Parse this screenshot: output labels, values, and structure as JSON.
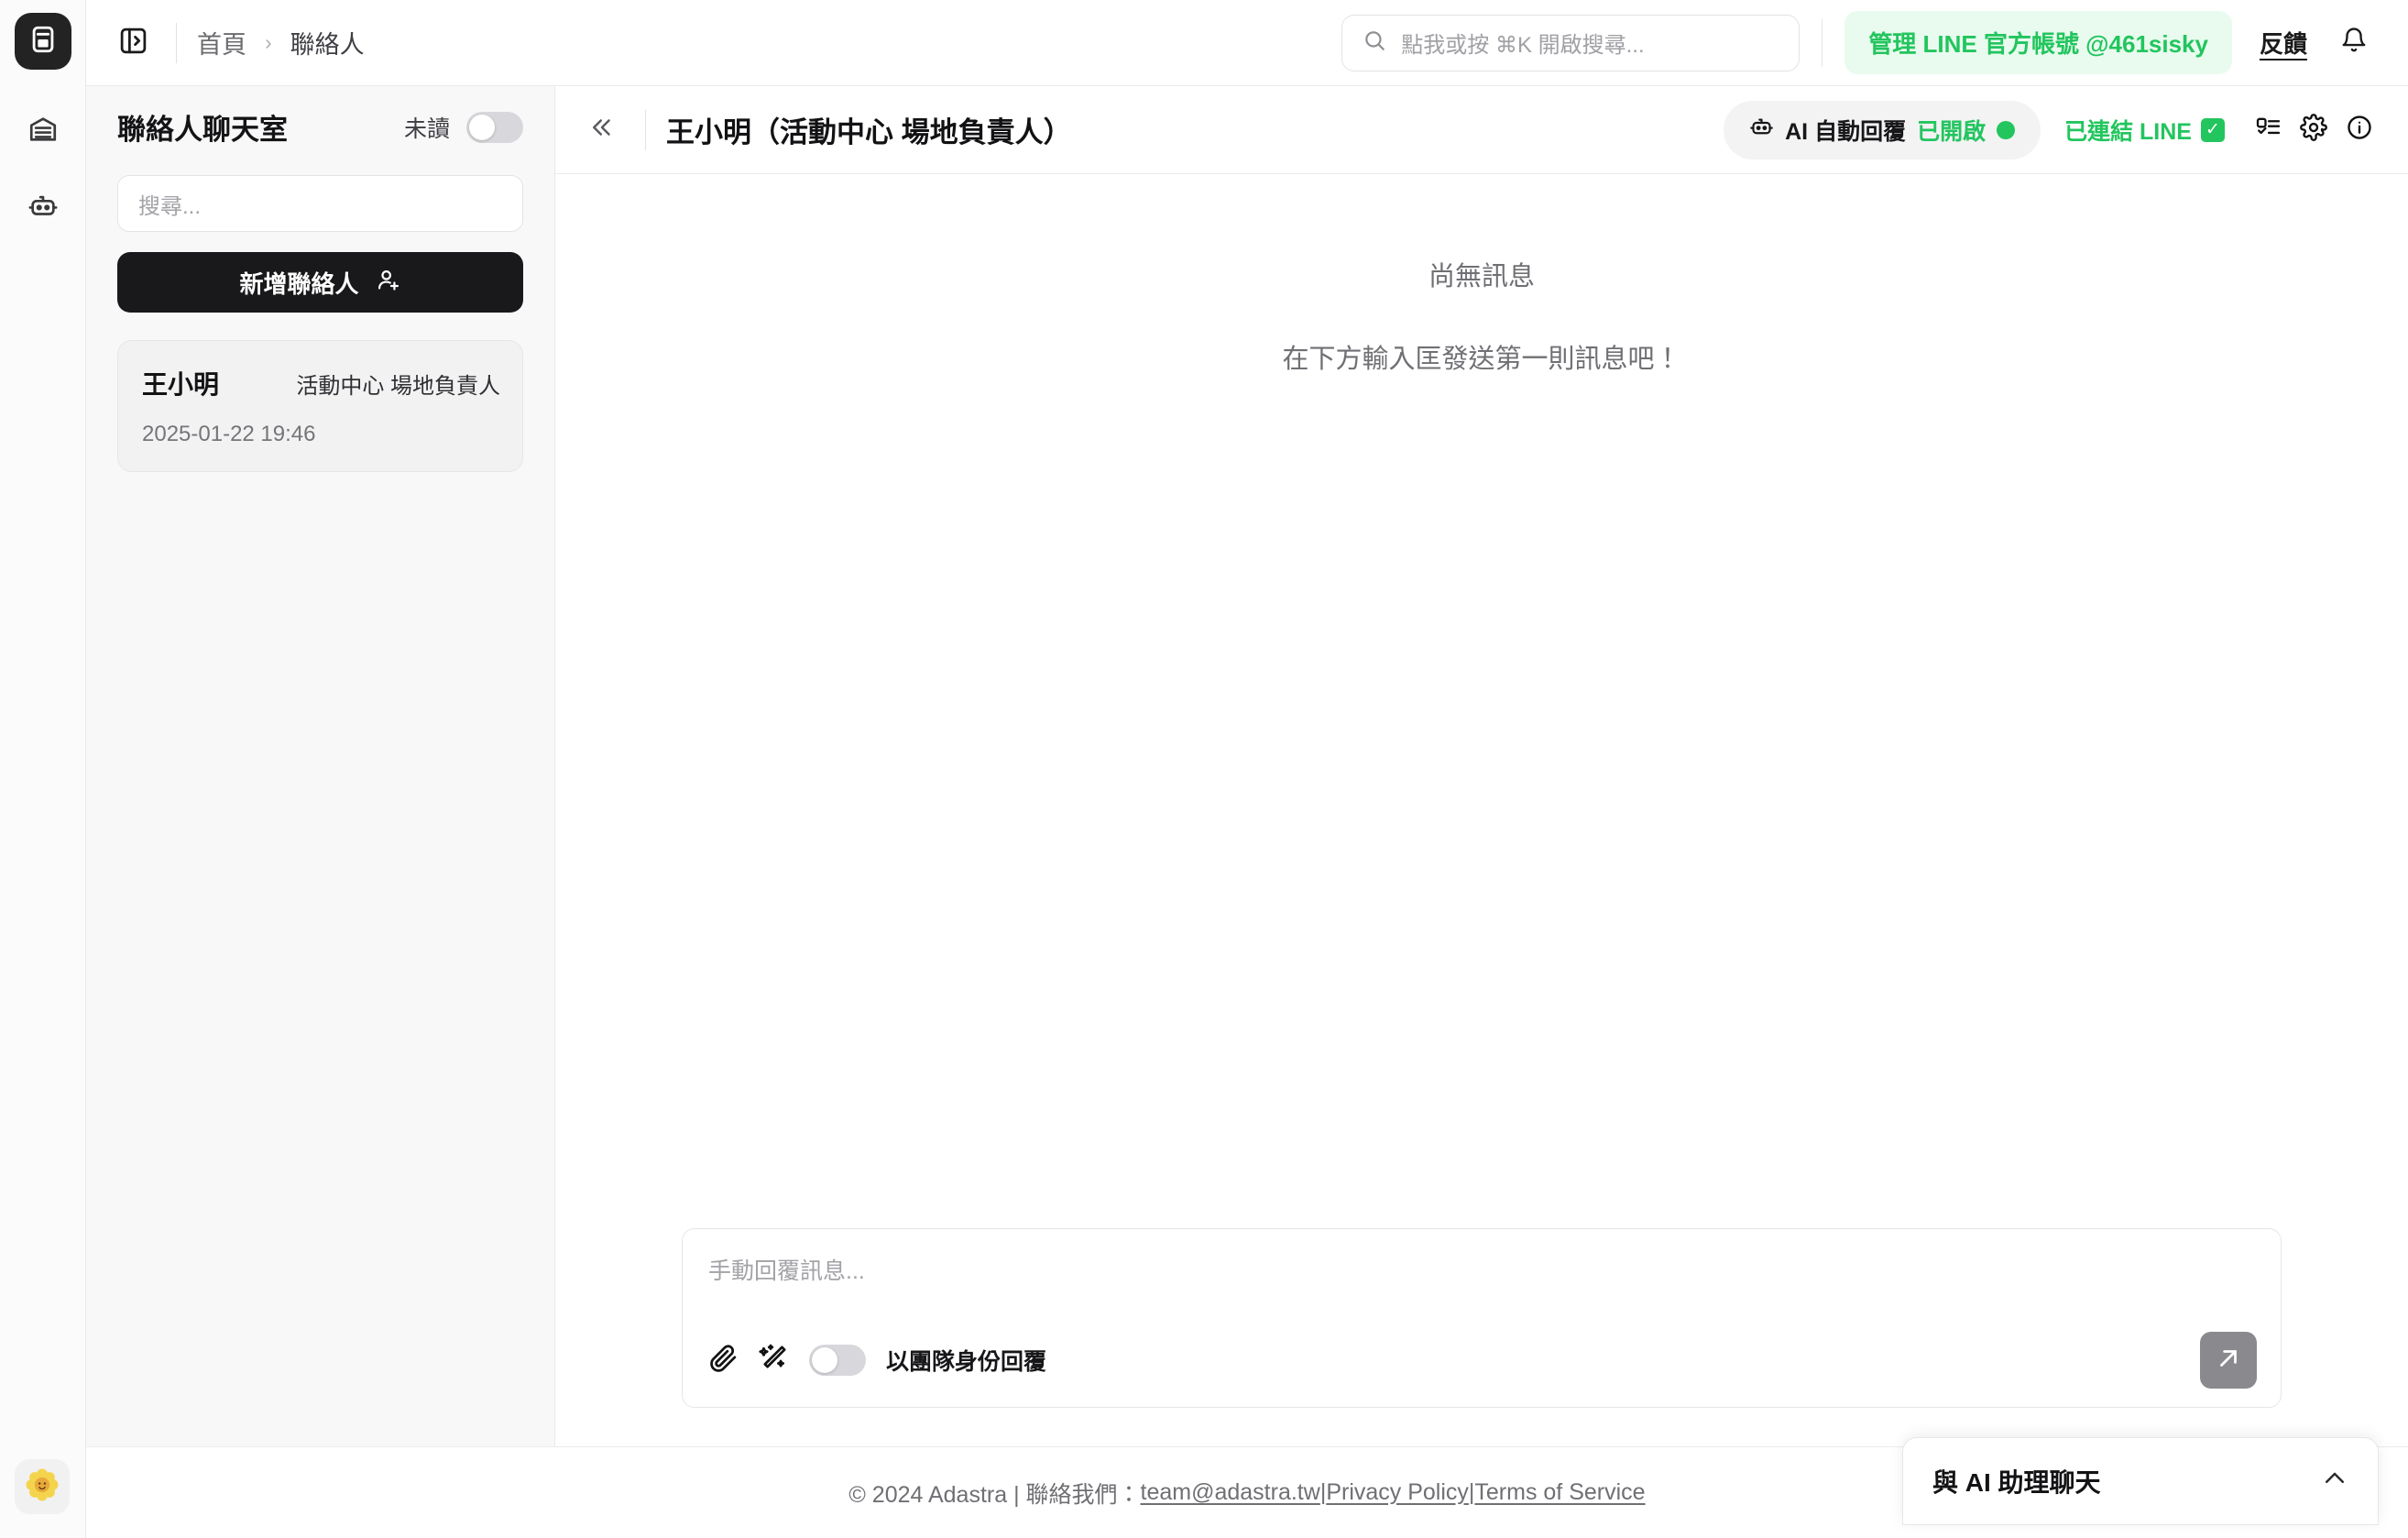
{
  "rail": {
    "logo_icon": "archive-box-icon",
    "items": [
      {
        "icon": "warehouse-icon",
        "name": "warehouse"
      },
      {
        "icon": "robot-icon",
        "name": "robot"
      }
    ],
    "avatar_icon": "sunflower-avatar-icon"
  },
  "topbar": {
    "sidebar_toggle_icon": "panel-expand-icon",
    "breadcrumb": {
      "home": "首頁",
      "separator": "›",
      "current": "聯絡人"
    },
    "search": {
      "icon": "search-icon",
      "placeholder": "點我或按 ⌘K 開啟搜尋..."
    },
    "line_button": "管理 LINE 官方帳號 @461sisky",
    "feedback": "反饋",
    "bell_icon": "bell-icon"
  },
  "panel": {
    "title": "聯絡人聊天室",
    "unread_label": "未讀",
    "unread_toggle_on": false,
    "search_placeholder": "搜尋...",
    "add_contact_label": "新增聯絡人",
    "add_contact_icon": "user-plus-icon",
    "contacts": [
      {
        "name": "王小明",
        "role": "活動中心  場地負責人",
        "timestamp": "2025-01-22 19:46"
      }
    ]
  },
  "chat": {
    "collapse_icon": "chevron-double-left-icon",
    "title": "王小明（活動中心 場地負責人）",
    "ai_pill": {
      "icon": "robot-icon",
      "label": "AI 自動回覆",
      "state": "已開啟",
      "state_color": "#22c55e"
    },
    "line_status": {
      "label": "已連結 LINE",
      "badge": "✓",
      "color": "#22c55e"
    },
    "actions": [
      {
        "icon": "checklist-icon",
        "name": "checklist"
      },
      {
        "icon": "gear-icon",
        "name": "settings"
      },
      {
        "icon": "info-circle-icon",
        "name": "info"
      }
    ],
    "empty_title": "尚無訊息",
    "empty_subtitle": "在下方輸入匡發送第一則訊息吧！",
    "composer": {
      "placeholder": "手動回覆訊息...",
      "attach_icon": "paperclip-icon",
      "magic_icon": "magic-wand-icon",
      "team_toggle_on": false,
      "team_label": "以團隊身份回覆",
      "send_icon": "arrow-up-right-icon"
    }
  },
  "footer": {
    "copyright": "© 2024 Adastra | 聯絡我們：",
    "email": "team@adastra.tw",
    "sep1": " | ",
    "privacy": "Privacy Policy",
    "sep2": " | ",
    "terms": "Terms of Service"
  },
  "ai_widget": {
    "title": "與 AI 助理聊天",
    "chevron_icon": "chevron-up-icon"
  }
}
